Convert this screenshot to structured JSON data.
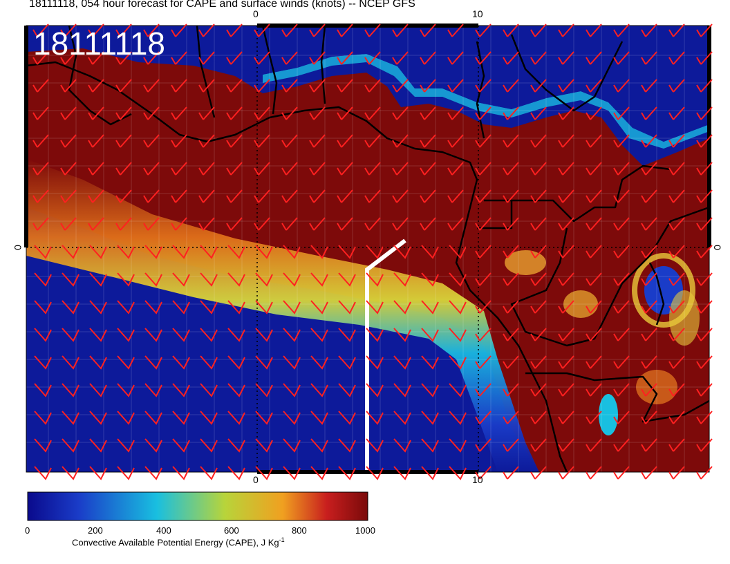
{
  "header": {
    "title": "18111118, 054 hour forecast for CAPE and surface winds (knots) -- NCEP GFS",
    "stamp": "18111118"
  },
  "axes": {
    "top_ticks": [
      "0",
      "10"
    ],
    "bottom_ticks": [
      "0",
      "10"
    ],
    "left_tick": "0",
    "right_tick": "0"
  },
  "colorbar": {
    "labels": [
      "0",
      "200",
      "400",
      "600",
      "800",
      "1000"
    ],
    "title": "Convective Available Potential Energy (CAPE), J Kg",
    "title_superscript": "-1",
    "range": [
      0,
      1000
    ],
    "colors": [
      "#0a0a8c",
      "#1a3cc8",
      "#19bfe0",
      "#b8d43a",
      "#f0a020",
      "#c81e1e",
      "#7a0a0a"
    ]
  },
  "colors": {
    "land_ocean_high": "#7d0a0a",
    "ocean_low": "#0d1a9a",
    "wind_barbs": "#ff2020",
    "coastlines": "#000000",
    "track": "#ffffff"
  }
}
